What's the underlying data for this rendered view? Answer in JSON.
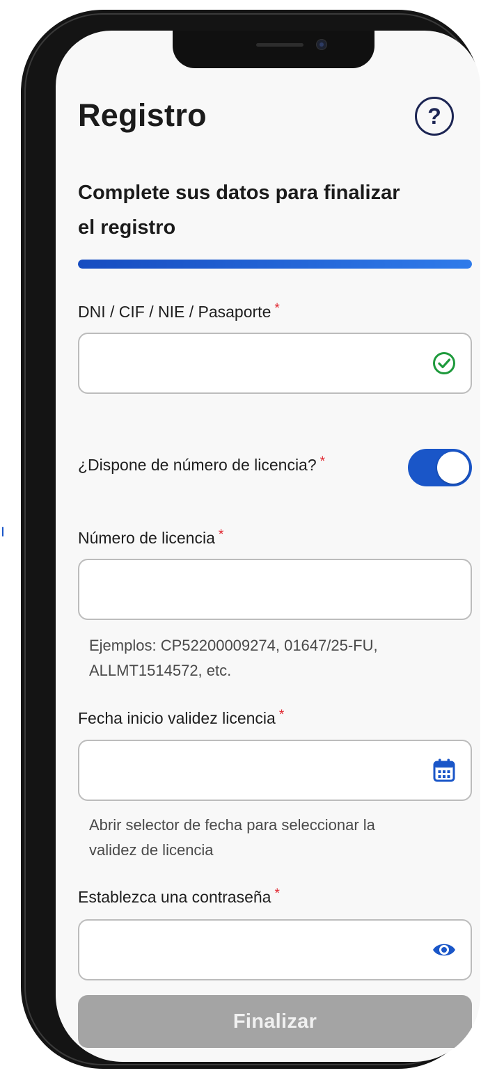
{
  "header": {
    "title": "Registro",
    "help_symbol": "?",
    "help_icon": "question-circle-icon"
  },
  "subtitle": "Complete sus datos para finalizar el registro",
  "progress": {
    "fraction": 1.0,
    "color": "#1a56c8"
  },
  "required_marker": "*",
  "fields": {
    "dni": {
      "label": "DNI / CIF / NIE / Pasaporte",
      "value": "",
      "icon": "check-circle-icon",
      "icon_color": "#1e9a3c"
    },
    "license_toggle": {
      "label": "¿Dispone de número de licencia?",
      "checked": true,
      "color": "#1a56c8"
    },
    "license_number": {
      "label": "Número de licencia",
      "value": "",
      "hint": "Ejemplos: CP52200009274, 01647/25-FU, ALLMT1514572, etc."
    },
    "license_start": {
      "label": "Fecha inicio validez licencia",
      "value": "",
      "icon": "calendar-icon",
      "icon_color": "#1a56c8",
      "hint": "Abrir selector de fecha para seleccionar la validez de licencia"
    },
    "password": {
      "label": "Establezca una contraseña",
      "value": "",
      "icon": "eye-icon",
      "icon_color": "#1a56c8"
    }
  },
  "submit": {
    "label": "Finalizar",
    "enabled": false,
    "color": "#a4a4a4"
  }
}
